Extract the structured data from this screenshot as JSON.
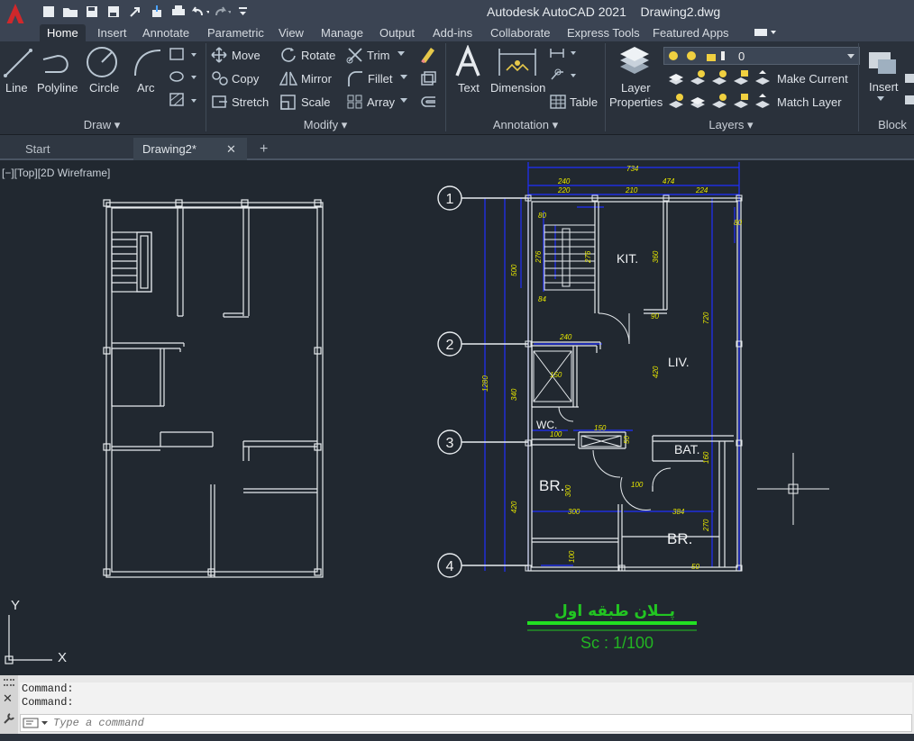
{
  "app": {
    "title": "Autodesk AutoCAD 2021",
    "document": "Drawing2.dwg",
    "logo_letter": "A"
  },
  "ribbon_tabs": [
    "Home",
    "Insert",
    "Annotate",
    "Parametric",
    "View",
    "Manage",
    "Output",
    "Add-ins",
    "Collaborate",
    "Express Tools",
    "Featured Apps"
  ],
  "active_tab": "Home",
  "draw": {
    "line": "Line",
    "polyline": "Polyline",
    "circle": "Circle",
    "arc": "Arc",
    "panel": "Draw"
  },
  "modify": {
    "move": "Move",
    "rotate": "Rotate",
    "trim": "Trim",
    "copy": "Copy",
    "mirror": "Mirror",
    "fillet": "Fillet",
    "stretch": "Stretch",
    "scale": "Scale",
    "array": "Array",
    "panel": "Modify"
  },
  "annotation": {
    "text": "Text",
    "dimension": "Dimension",
    "table": "Table",
    "panel": "Annotation"
  },
  "layers": {
    "properties_line1": "Layer",
    "properties_line2": "Properties",
    "current_layer": "0",
    "make_current": "Make Current",
    "match_layer": "Match Layer",
    "panel": "Layers"
  },
  "block": {
    "insert": "Insert",
    "panel": "Block"
  },
  "file_tabs": {
    "start": "Start",
    "drawing": "Drawing2*",
    "close": "✕",
    "new": "+"
  },
  "viewport": {
    "label": "[−][Top][2D Wireframe]"
  },
  "plan": {
    "grid_labels": [
      "1",
      "2",
      "3",
      "4"
    ],
    "rooms": {
      "kitchen": "KIT.",
      "living": "LIV.",
      "wc": "WC.",
      "bath": "BAT.",
      "bedroom1": "BR.",
      "bedroom2": "BR."
    },
    "title_arabic": "پــلان طبقه اول",
    "scale": "Sc : 1/100",
    "dims_top": [
      "734",
      "474",
      "240",
      "220",
      "210",
      "224"
    ],
    "dims_inner": [
      "80",
      "276",
      "276",
      "300",
      "360",
      "84",
      "90",
      "240",
      "150",
      "160",
      "100",
      "160",
      "150",
      "100",
      "300",
      "420",
      "384",
      "270",
      "100",
      "720",
      "420",
      "340",
      "1280",
      "500",
      "80",
      "160",
      "50"
    ]
  },
  "ucs": {
    "y": "Y",
    "x": "X"
  },
  "command": {
    "history": [
      "Command:",
      "Command:"
    ],
    "placeholder": "Type a command"
  },
  "colors": {
    "background": "#212830",
    "ribbon": "#2a313b",
    "titlebar": "#3b4453",
    "dimension": "#1f2fff",
    "text_yellow": "#e6e600",
    "title_green": "#22c522",
    "scale_green": "#22b522",
    "logo_red": "#d0282b"
  }
}
